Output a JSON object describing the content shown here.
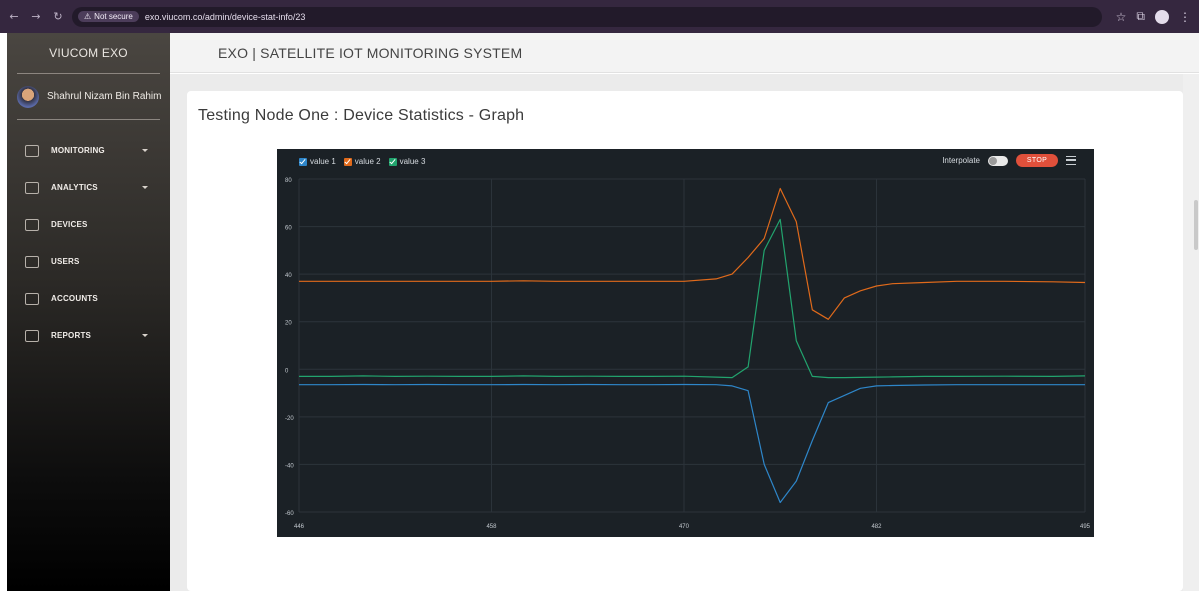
{
  "browser": {
    "security_label": "Not secure",
    "url": "exo.viucom.co/admin/device-stat-info/23"
  },
  "sidebar": {
    "brand": "VIUCOM EXO",
    "user_name": "Shahrul Nizam Bin Rahim",
    "items": [
      {
        "label": "MONITORING",
        "icon": "monitor-icon",
        "has_caret": true
      },
      {
        "label": "ANALYTICS",
        "icon": "analytics-icon",
        "has_caret": true
      },
      {
        "label": "DEVICES",
        "icon": "devices-icon",
        "has_caret": false
      },
      {
        "label": "USERS",
        "icon": "users-icon",
        "has_caret": false
      },
      {
        "label": "ACCOUNTS",
        "icon": "accounts-icon",
        "has_caret": false
      },
      {
        "label": "REPORTS",
        "icon": "reports-icon",
        "has_caret": true
      }
    ]
  },
  "header": {
    "title": "EXO | SATELLITE IOT MONITORING SYSTEM"
  },
  "main": {
    "title": "Testing Node One : Device Statistics - Graph"
  },
  "chart_controls": {
    "interpolate_label": "Interpolate",
    "stop_label": "STOP"
  },
  "colors": {
    "value1": "#2e86c9",
    "value2": "#e06a1b",
    "value3": "#22a46e",
    "stop": "#e0503b"
  },
  "chart_data": {
    "type": "line",
    "xlim": [
      446,
      495
    ],
    "ylim": [
      -60,
      80
    ],
    "x_ticks": [
      446,
      458,
      470,
      482,
      495
    ],
    "y_ticks": [
      80,
      60,
      40,
      20,
      0,
      -20,
      -40,
      -60
    ],
    "x": [
      446,
      448,
      450,
      452,
      454,
      456,
      458,
      460,
      462,
      464,
      466,
      468,
      470,
      472,
      473,
      474,
      475,
      476,
      477,
      478,
      479,
      480,
      481,
      482,
      483,
      485,
      487,
      490,
      493,
      495
    ],
    "series": [
      {
        "name": "value 1",
        "values": [
          -6.5,
          -6.5,
          -6.4,
          -6.5,
          -6.4,
          -6.5,
          -6.5,
          -6.4,
          -6.5,
          -6.4,
          -6.5,
          -6.5,
          -6.4,
          -6.5,
          -7,
          -9,
          -40,
          -56,
          -47,
          -30,
          -14,
          -11,
          -8,
          -7,
          -6.8,
          -6.6,
          -6.5,
          -6.5,
          -6.5,
          -6.5
        ]
      },
      {
        "name": "value 2",
        "values": [
          37,
          37,
          37,
          37,
          37,
          37,
          37,
          37.2,
          37,
          37,
          37,
          37,
          37,
          38,
          40,
          47,
          55,
          76,
          62,
          25,
          21,
          30,
          33,
          35,
          36,
          36.5,
          37,
          37,
          36.8,
          36.5
        ]
      },
      {
        "name": "value 3",
        "values": [
          -3,
          -3,
          -2.8,
          -3,
          -2.9,
          -3,
          -3,
          -2.8,
          -3,
          -2.9,
          -3,
          -3,
          -2.9,
          -3.3,
          -3.5,
          1,
          50,
          63,
          12,
          -3,
          -3.5,
          -3.5,
          -3.4,
          -3.3,
          -3.2,
          -3,
          -3,
          -2.9,
          -3,
          -2.8
        ]
      }
    ]
  }
}
